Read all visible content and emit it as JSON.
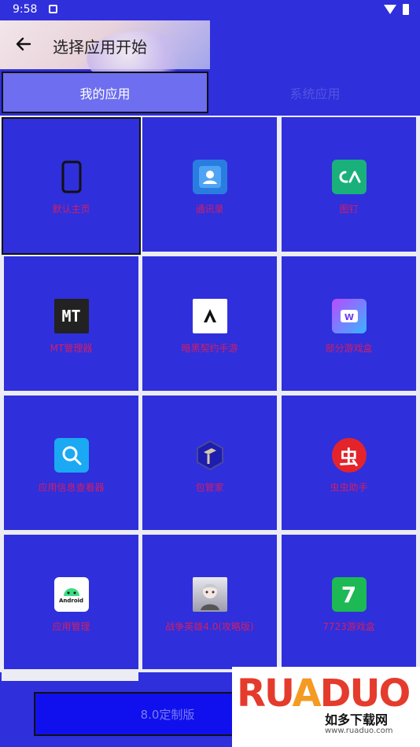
{
  "status": {
    "time": "9:58"
  },
  "header": {
    "title": "选择应用开始"
  },
  "tabs": [
    {
      "label": "我的应用",
      "active": true
    },
    {
      "label": "系统应用",
      "active": false
    }
  ],
  "apps": [
    {
      "label": "默认主页",
      "icon": "phone-icon"
    },
    {
      "label": "通讯录",
      "icon": "contacts-icon"
    },
    {
      "label": "图钉",
      "icon": "pin-app-icon"
    },
    {
      "label": "MT管理器",
      "icon": "mt-manager-icon"
    },
    {
      "label": "暗黑契约手游",
      "icon": "dark-contract-icon"
    },
    {
      "label": "部分游戏盒",
      "icon": "game-box-icon"
    },
    {
      "label": "应用信息查看器",
      "icon": "app-info-icon"
    },
    {
      "label": "包管家",
      "icon": "package-box-icon"
    },
    {
      "label": "虫虫助手",
      "icon": "chongchong-icon"
    },
    {
      "label": "应用管理",
      "icon": "android-icon"
    },
    {
      "label": "战争英雄4.0(攻略版)",
      "icon": "anime-avatar-icon"
    },
    {
      "label": "7723游戏盒",
      "icon": "7723-icon"
    }
  ],
  "bottom": {
    "button_label": "8.0定制版"
  },
  "watermark": {
    "brand": "RUADUO",
    "sub1": "如多下载网",
    "sub2": "www.ruaduo.com"
  },
  "colors": {
    "background": "#2f2fdc",
    "label": "#d21f64",
    "grid_line": "#ececf4"
  }
}
